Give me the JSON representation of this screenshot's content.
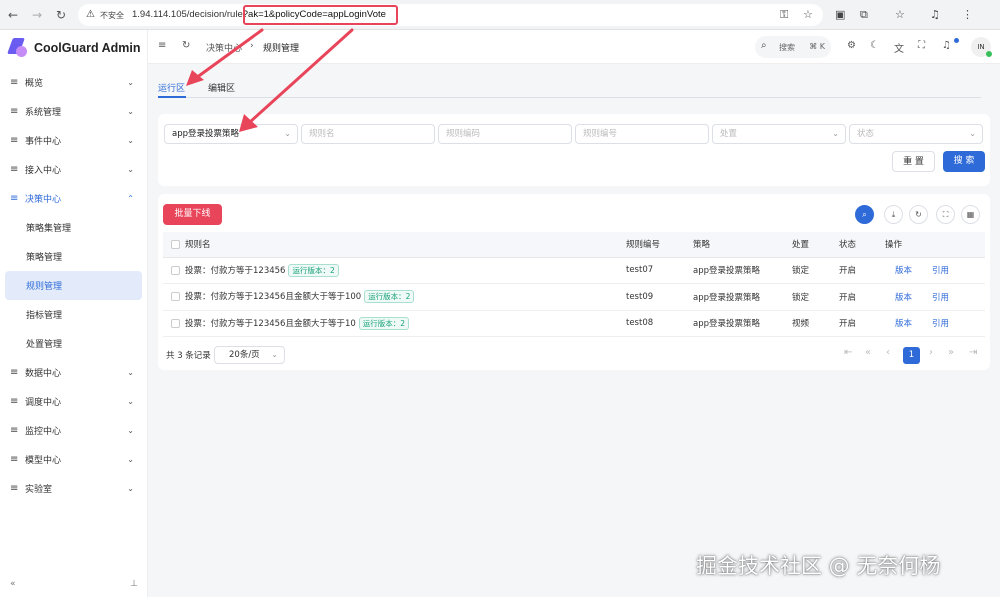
{
  "browser": {
    "security_label": "不安全",
    "url_base": "1.94.114.105/decision/rule",
    "url_query": "?ak=1&policyCode=appLoginVote"
  },
  "app": {
    "brand": "CoolGuard Admin"
  },
  "sidebar": {
    "items": [
      {
        "label": "概览"
      },
      {
        "label": "系统管理"
      },
      {
        "label": "事件中心"
      },
      {
        "label": "接入中心"
      },
      {
        "label": "决策中心"
      },
      {
        "label": "数据中心"
      },
      {
        "label": "调度中心"
      },
      {
        "label": "监控中心"
      },
      {
        "label": "模型中心"
      },
      {
        "label": "实验室"
      }
    ],
    "submenu": [
      {
        "label": "策略集管理"
      },
      {
        "label": "策略管理"
      },
      {
        "label": "规则管理"
      },
      {
        "label": "指标管理"
      },
      {
        "label": "处置管理"
      }
    ],
    "collapse_icon": "«"
  },
  "header": {
    "breadcrumb": [
      "决策中心",
      "规则管理"
    ],
    "search_label": "搜索",
    "search_shortcut": "⌘ K",
    "avatar": "IN"
  },
  "tabs": [
    {
      "label": "运行区",
      "active": true
    },
    {
      "label": "编辑区",
      "active": false
    }
  ],
  "filters": {
    "policy_value": "app登录投票策略",
    "rule_name_placeholder": "规则名",
    "rule_code_placeholder": "规则编码",
    "rule_no_placeholder": "规则编号",
    "disposal_placeholder": "处置",
    "status_placeholder": "状态",
    "reset_label": "重 置",
    "search_label": "搜 索"
  },
  "table": {
    "batch_offline": "批量下线",
    "columns": [
      "规则名",
      "规则编号",
      "策略",
      "处置",
      "状态",
      "操作"
    ],
    "rows": [
      {
        "name": "投票：付款方等于123456",
        "tag": "运行版本：2",
        "code": "test07",
        "policy": "app登录投票策略",
        "disposal": "锁定",
        "status": "开启",
        "action1": "版本",
        "action2": "引用"
      },
      {
        "name": "投票：付款方等于123456且金额大于等于100",
        "tag": "运行版本：2",
        "code": "test09",
        "policy": "app登录投票策略",
        "disposal": "锁定",
        "status": "开启",
        "action1": "版本",
        "action2": "引用"
      },
      {
        "name": "投票：付款方等于123456且金额大于等于10",
        "tag": "运行版本：2",
        "code": "test08",
        "policy": "app登录投票策略",
        "disposal": "视频",
        "status": "开启",
        "action1": "版本",
        "action2": "引用"
      }
    ]
  },
  "pagination": {
    "total": "共 3 条记录",
    "page_size": "20条/页",
    "current_page": "1"
  },
  "watermark": "掘金技术社区 @ 无奈何杨",
  "colors": {
    "primary": "#2f6bd8",
    "danger": "#e8455a",
    "tag_green": "#18a17a",
    "annotation_red": "#e8455a"
  }
}
